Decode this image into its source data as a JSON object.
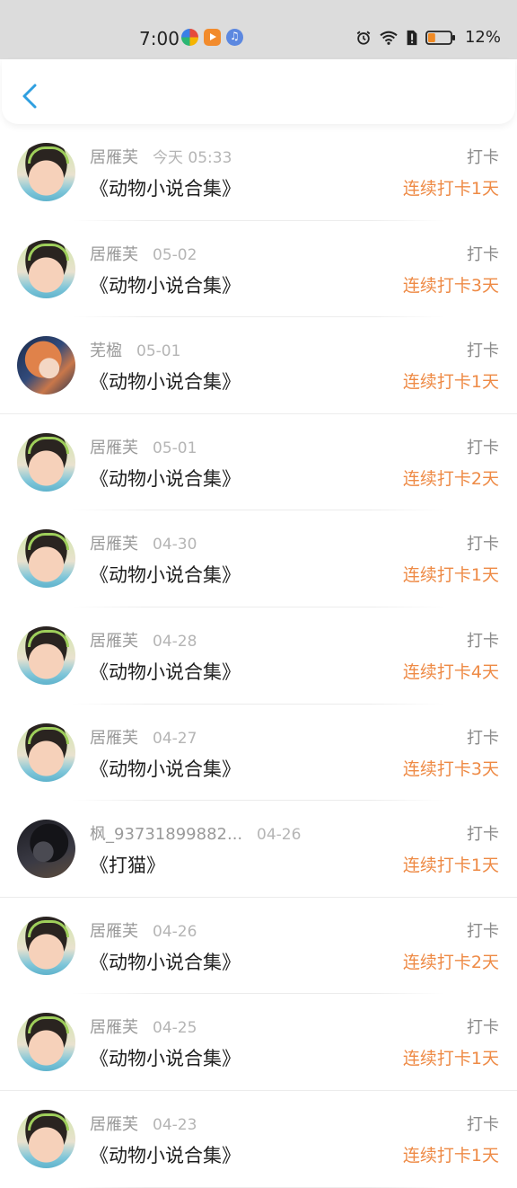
{
  "status_bar": {
    "time": "7:00",
    "battery_percent": "12%",
    "battery_level": 0.12,
    "icons": [
      "app-pinwheel-icon",
      "app-video-icon",
      "app-music-icon",
      "alarm-icon",
      "wifi-icon",
      "sim-alert-icon",
      "battery-icon"
    ]
  },
  "header": {
    "back_icon": "chevron-left-icon",
    "accent_color": "#2f9fe0"
  },
  "colors": {
    "streak": "#ee8a45",
    "muted": "#9a9a9a"
  },
  "records": [
    {
      "name": "居雁芙",
      "time": "今天 05:33",
      "title": "《动物小说合集》",
      "action": "打卡",
      "streak": "连续打卡1天",
      "avatar": "kid-photo-avatar"
    },
    {
      "name": "居雁芙",
      "time": "05-02",
      "title": "《动物小说合集》",
      "action": "打卡",
      "streak": "连续打卡3天",
      "avatar": "kid-photo-avatar"
    },
    {
      "name": "芜楹",
      "time": "05-01",
      "title": "《动物小说合集》",
      "action": "打卡",
      "streak": "连续打卡1天",
      "avatar": "anime-avatar"
    },
    {
      "name": "居雁芙",
      "time": "05-01",
      "title": "《动物小说合集》",
      "action": "打卡",
      "streak": "连续打卡2天",
      "avatar": "kid-photo-avatar"
    },
    {
      "name": "居雁芙",
      "time": "04-30",
      "title": "《动物小说合集》",
      "action": "打卡",
      "streak": "连续打卡1天",
      "avatar": "kid-photo-avatar"
    },
    {
      "name": "居雁芙",
      "time": "04-28",
      "title": "《动物小说合集》",
      "action": "打卡",
      "streak": "连续打卡4天",
      "avatar": "kid-photo-avatar"
    },
    {
      "name": "居雁芙",
      "time": "04-27",
      "title": "《动物小说合集》",
      "action": "打卡",
      "streak": "连续打卡3天",
      "avatar": "kid-photo-avatar"
    },
    {
      "name": "枫_93731899882...",
      "time": "04-26",
      "title": "《打猫》",
      "action": "打卡",
      "streak": "连续打卡1天",
      "avatar": "dark-photo-avatar"
    },
    {
      "name": "居雁芙",
      "time": "04-26",
      "title": "《动物小说合集》",
      "action": "打卡",
      "streak": "连续打卡2天",
      "avatar": "kid-photo-avatar"
    },
    {
      "name": "居雁芙",
      "time": "04-25",
      "title": "《动物小说合集》",
      "action": "打卡",
      "streak": "连续打卡1天",
      "avatar": "kid-photo-avatar"
    },
    {
      "name": "居雁芙",
      "time": "04-23",
      "title": "《动物小说合集》",
      "action": "打卡",
      "streak": "连续打卡1天",
      "avatar": "kid-photo-avatar"
    }
  ]
}
